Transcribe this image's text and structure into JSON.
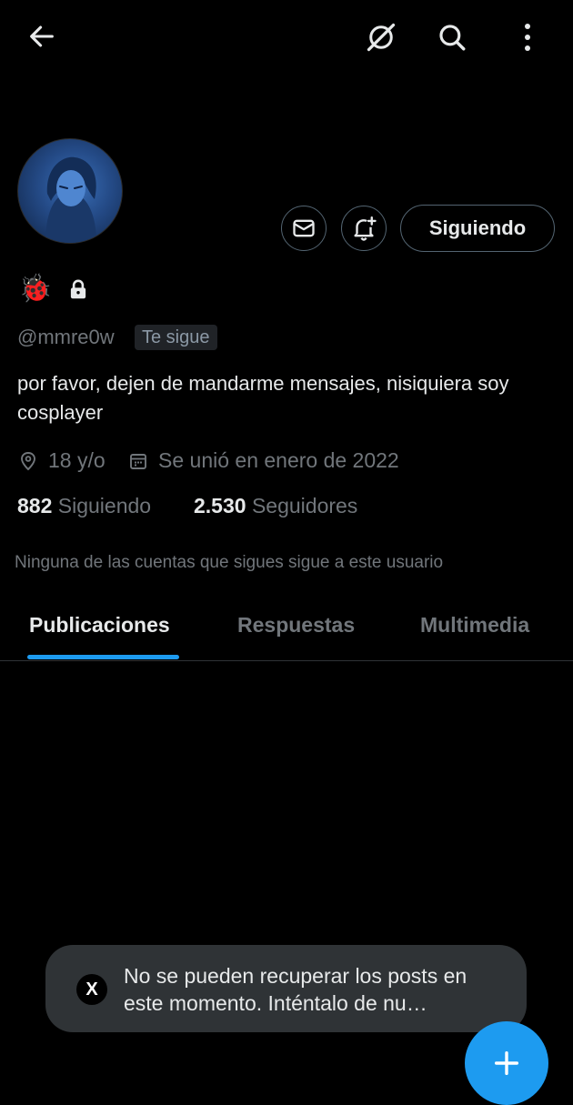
{
  "header": {
    "back_icon": "arrow-left-icon",
    "grok_icon": "grok-icon",
    "search_icon": "search-icon",
    "more_icon": "more-vertical-icon"
  },
  "profile": {
    "avatar_icon": "avatar",
    "emoji": "🐞",
    "lock_icon": "lock-icon",
    "handle": "@mmre0w",
    "follows_you_badge": "Te sigue",
    "bio": "por favor, dejen de mandarme mensajes, nisiquiera soy cosplayer",
    "location_icon": "location-pin-icon",
    "location": "18 y/o",
    "calendar_icon": "calendar-icon",
    "joined": "Se unió en enero de 2022",
    "following_count": "882",
    "following_label": "Siguiendo",
    "followers_count": "2.530",
    "followers_label": "Seguidores",
    "mutual_note": "Ninguna de las cuentas que sigues sigue a este usuario"
  },
  "actions": {
    "message_icon": "envelope-icon",
    "notify_icon": "bell-plus-icon",
    "follow_button_label": "Siguiendo"
  },
  "tabs": [
    {
      "label": "Publicaciones",
      "active": true
    },
    {
      "label": "Respuestas",
      "active": false
    },
    {
      "label": "Multimedia",
      "active": false
    }
  ],
  "toast": {
    "logo": "X",
    "message": "No se pueden recuperar los posts en este momento. Inténtalo de nu…"
  },
  "fab": {
    "icon": "plus-icon"
  },
  "colors": {
    "accent": "#1d9bf0",
    "background": "#000000",
    "muted": "#71767b"
  }
}
